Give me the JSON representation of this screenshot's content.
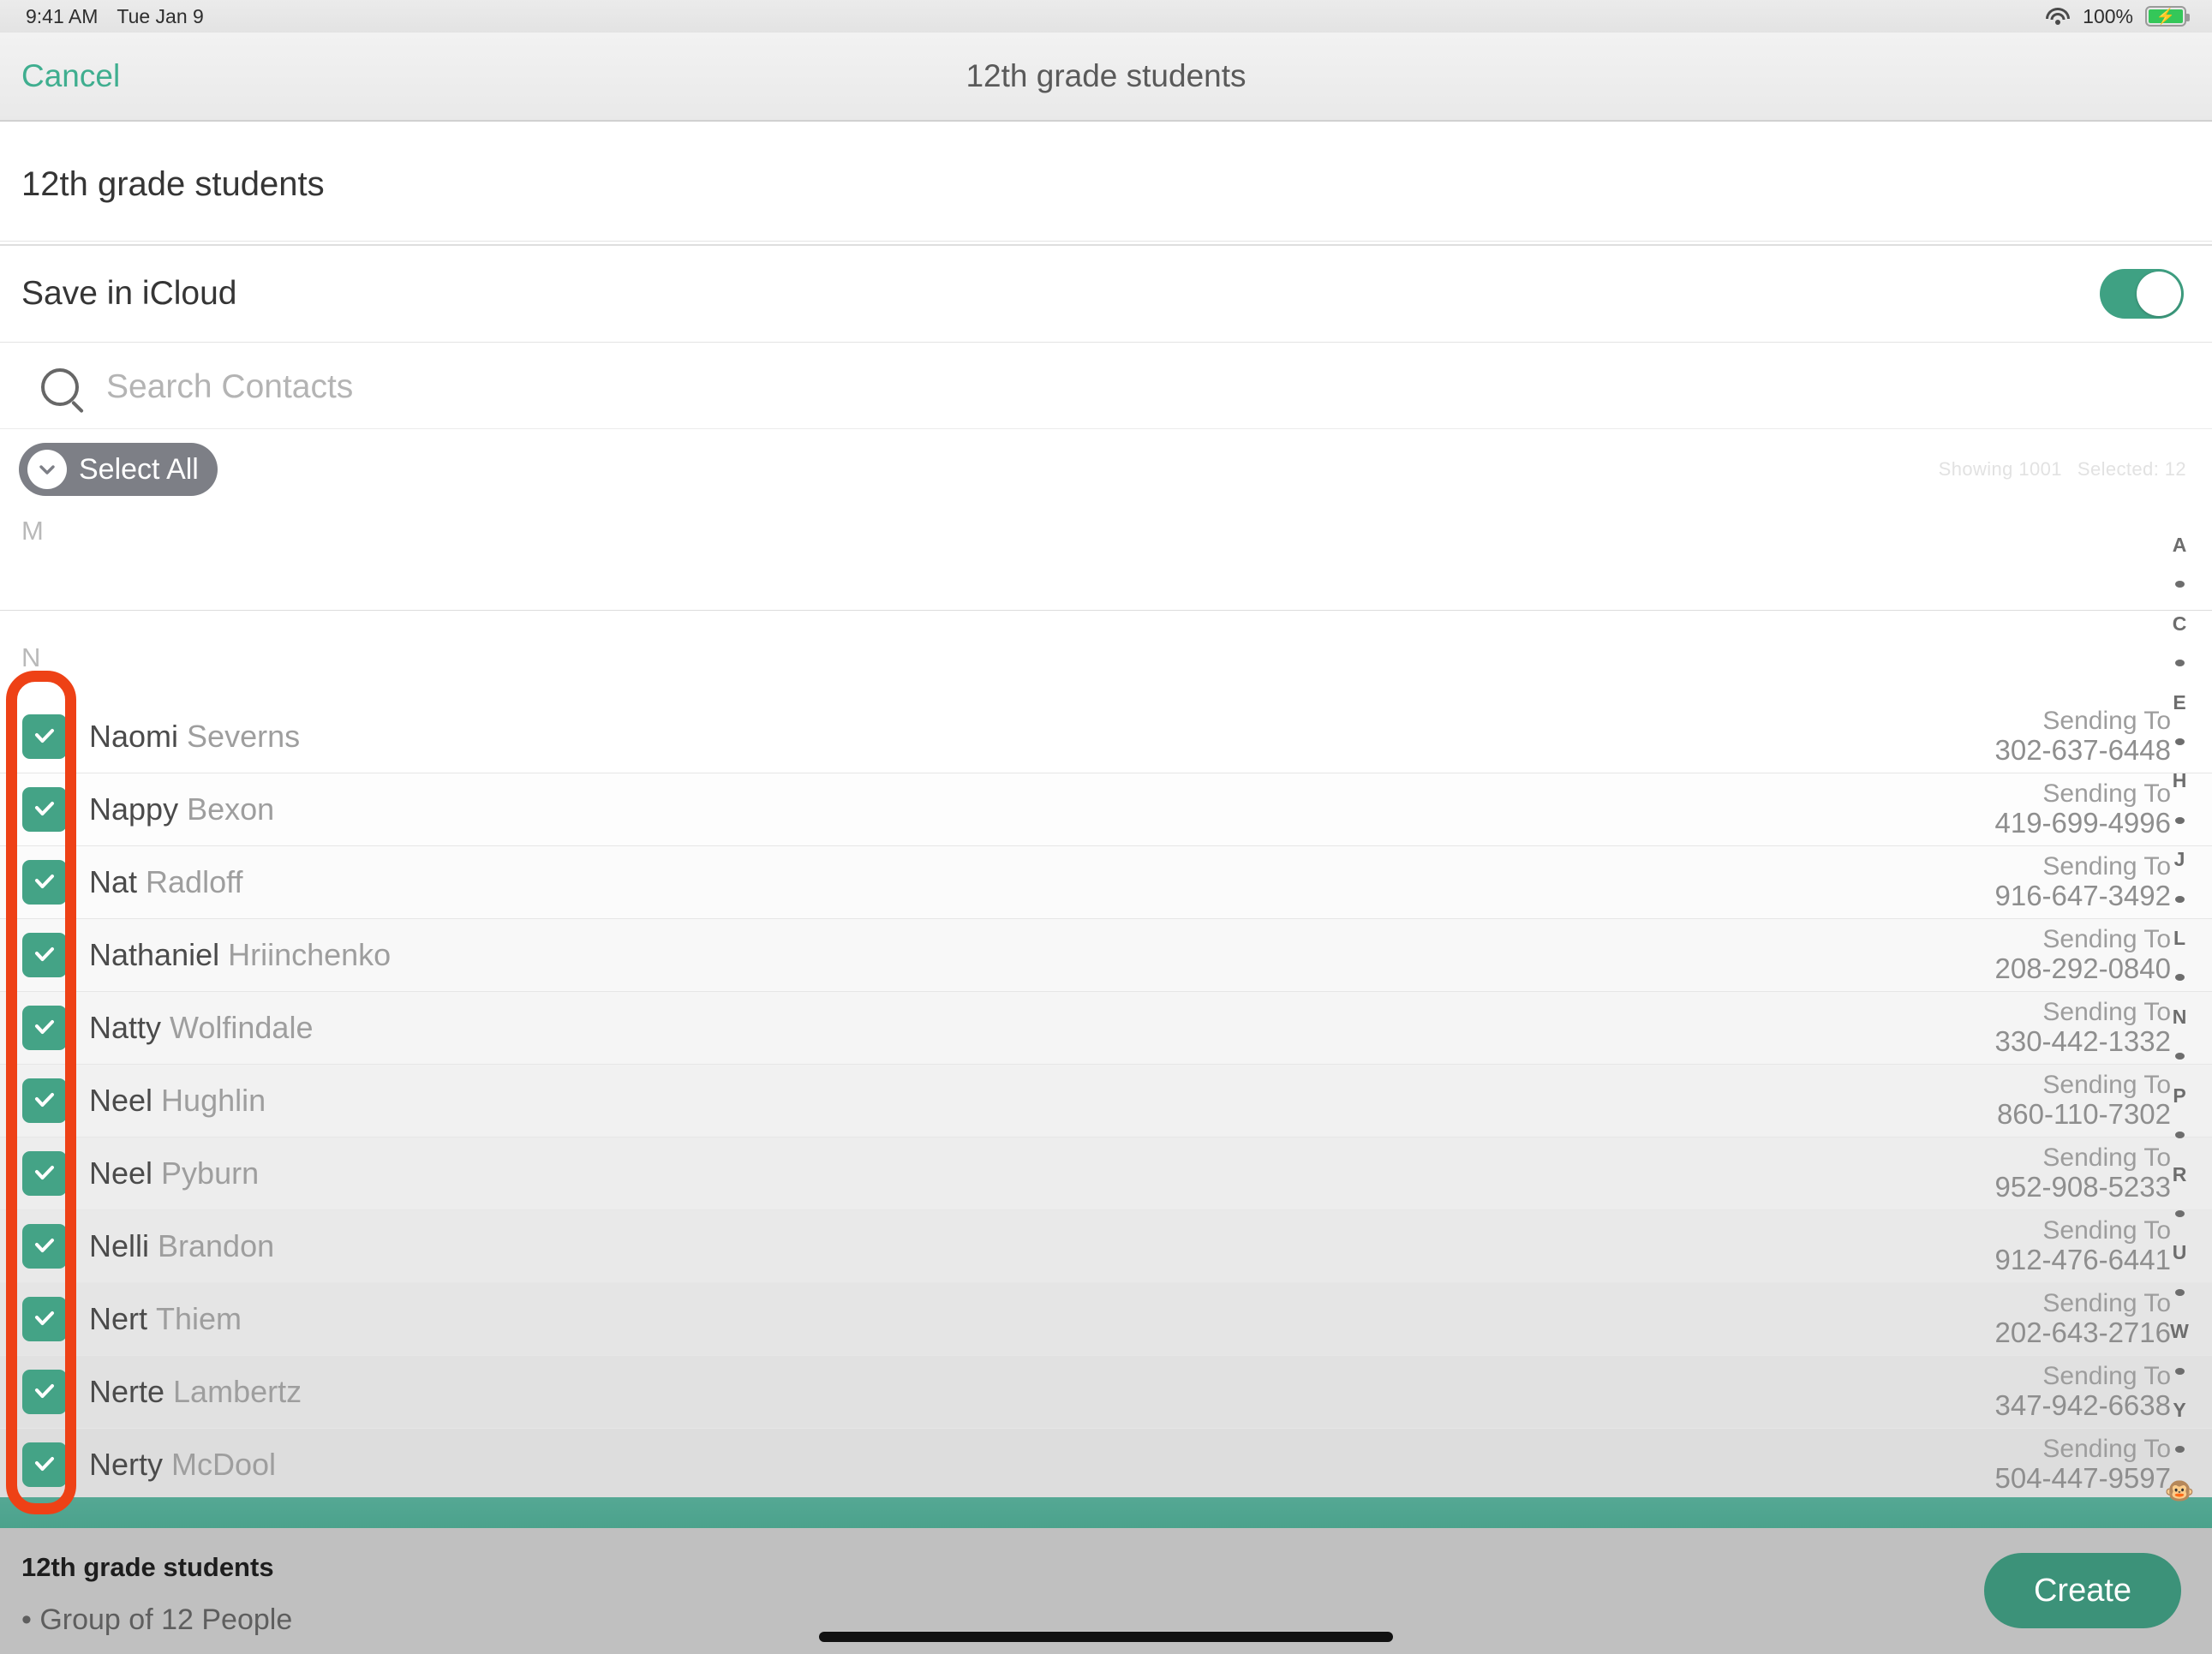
{
  "status_bar": {
    "time": "9:41 AM",
    "date": "Tue Jan 9",
    "battery_percent": "100%",
    "wifi_icon": "wifi-icon",
    "battery_icon": "battery-charging-icon"
  },
  "nav_bar": {
    "cancel_label": "Cancel",
    "title": "12th grade students"
  },
  "group_name_field": {
    "value": "12th grade students"
  },
  "icloud_row": {
    "label": "Save in iCloud",
    "toggle_state": "on"
  },
  "search": {
    "placeholder": "Search Contacts",
    "value": "",
    "icon": "search-icon"
  },
  "select_bar": {
    "select_all_label": "Select All",
    "chevron_icon": "chevron-down-icon",
    "showing_label": "Showing 1001",
    "selected_label": "Selected: 12"
  },
  "sections": [
    {
      "letter": "M",
      "rows": []
    },
    {
      "letter": "N",
      "rows": [
        {
          "first": "Naomi",
          "last": "Severns",
          "sending_to": "Sending To",
          "phone": "302-637-6448",
          "checked": true
        },
        {
          "first": "Nappy",
          "last": "Bexon",
          "sending_to": "Sending To",
          "phone": "419-699-4996",
          "checked": true
        },
        {
          "first": "Nat",
          "last": "Radloff",
          "sending_to": "Sending To",
          "phone": "916-647-3492",
          "checked": true
        },
        {
          "first": "Nathaniel",
          "last": "Hriinchenko",
          "sending_to": "Sending To",
          "phone": "208-292-0840",
          "checked": true
        },
        {
          "first": "Natty",
          "last": "Wolfindale",
          "sending_to": "Sending To",
          "phone": "330-442-1332",
          "checked": true
        },
        {
          "first": "Neel",
          "last": "Hughlin",
          "sending_to": "Sending To",
          "phone": "860-110-7302",
          "checked": true
        },
        {
          "first": "Neel",
          "last": "Pyburn",
          "sending_to": "Sending To",
          "phone": "952-908-5233",
          "checked": true
        },
        {
          "first": "Nelli",
          "last": "Brandon",
          "sending_to": "Sending To",
          "phone": "912-476-6441",
          "checked": true
        },
        {
          "first": "Nert",
          "last": "Thiem",
          "sending_to": "Sending To",
          "phone": "202-643-2716",
          "checked": true
        },
        {
          "first": "Nerte",
          "last": "Lambertz",
          "sending_to": "Sending To",
          "phone": "347-942-6638",
          "checked": true
        },
        {
          "first": "Nerty",
          "last": "McDool",
          "sending_to": "Sending To",
          "phone": "504-447-9597",
          "checked": true
        }
      ]
    }
  ],
  "alphabet_index": [
    "A",
    "•",
    "C",
    "•",
    "E",
    "•",
    "H",
    "•",
    "J",
    "•",
    "L",
    "•",
    "N",
    "•",
    "P",
    "•",
    "R",
    "•",
    "U",
    "•",
    "W",
    "•",
    "Y",
    "•",
    "🐵"
  ],
  "bottom_panel": {
    "group_title": "12th grade students",
    "group_detail": "• Group of 12 People",
    "create_label": "Create"
  },
  "colors": {
    "accent_green": "#3fa183",
    "create_green": "#3c9279",
    "checkbox_green": "#44a386",
    "cancel_teal": "#3fae8f",
    "annotation_red": "#ee4116",
    "select_all_gray": "#7d7f86"
  }
}
